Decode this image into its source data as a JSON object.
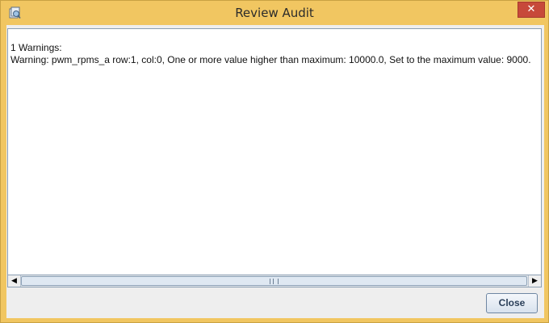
{
  "window": {
    "title": "Review Audit",
    "close_glyph": "✕",
    "app_icon": "audit-app-icon"
  },
  "log": {
    "lines": [
      "1 Warnings:",
      "Warning: pwm_rpms_a row:1, col:0, One or more value higher than maximum: 10000.0, Set to the maximum value: 9000."
    ]
  },
  "scrollbar": {
    "left_arrow": "◀",
    "right_arrow": "▶"
  },
  "footer": {
    "close_label": "Close"
  },
  "colors": {
    "title_bar": "#f1c661",
    "close_red": "#c7493a",
    "panel_border": "#8c9fb3"
  }
}
